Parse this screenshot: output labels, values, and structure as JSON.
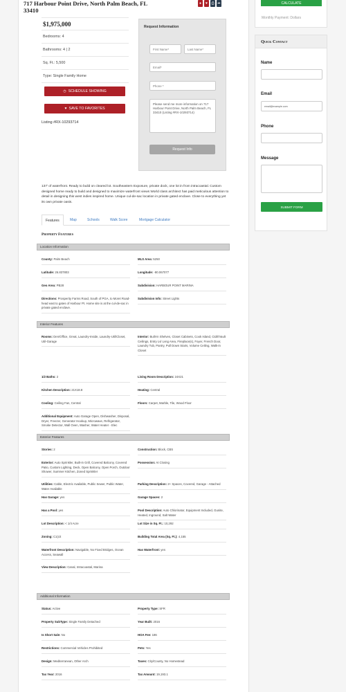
{
  "listing": {
    "address": "717 Harbour Point Drive, North Palm Beach, FL 33410",
    "price": "$1,975,000",
    "summary": [
      "Bedrooms: 4",
      "Bathrooms: 4 | 2",
      "Sq. Ft.: 5,500",
      "Type: Single Family Home"
    ],
    "schedule_label": "SCHEDULE SHOWING",
    "favorites_label": "SAVE TO FAVORITES",
    "listing_number": "Listing #RX-10293714"
  },
  "request_form": {
    "title": "Request Information",
    "first_name_placeholder": "First Name*",
    "last_name_placeholder": "Last Name*",
    "email_placeholder": "Email*",
    "phone_placeholder": "Phone *",
    "message_value": "Please send me more information on 717 Harbour Point Drive, North Palm Beach, FL 33410 (Listing #RX-10293714)",
    "submit_label": "Request Info"
  },
  "description": "137' of waterfront. Ready to build on cleared lot. Southeastern Exposure, private dock, one lot in from intracoastal. Custom designed home ready to build and designed to maximize waterfront views World class architect has paid meticulous attention to detail in designing this west indies inspired home. Unique cul-de-sac location in private gated enclave. Close to everything yet its own private oasis.",
  "tabs": [
    "Features",
    "Map",
    "Schools",
    "Walk Score",
    "Mortgage Calculator"
  ],
  "property_features_heading": "Property Features",
  "sections": [
    {
      "title": "Location Information",
      "items": [
        {
          "label": "County:",
          "value": "Palm Beach"
        },
        {
          "label": "MLS Area:",
          "value": "5250"
        },
        {
          "label": "Latitude:",
          "value": "26.837803"
        },
        {
          "label": "Longitude:",
          "value": "-80.067077"
        },
        {
          "label": "Geo Area:",
          "value": "PB28"
        },
        {
          "label": "Subdivision:",
          "value": "HARBOUR POINT MARINA"
        },
        {
          "label": "Directions:",
          "value": "Prosperity Farms Road, South of PGA, to Moret Road-head east to gates of Harbour Pt. Home site is at the cul-de-sac in private gated enclave."
        },
        {
          "label": "Subdivision Info:",
          "value": "Street Lights"
        }
      ]
    },
    {
      "title": "Interior Features",
      "items": [
        {
          "label": "Rooms:",
          "value": "Den/Office, Great, Laundry-Inside, Laundry-Util/Closet, Util-Garage"
        },
        {
          "label": "Interior:",
          "value": "Built-in Shelves, Closet Cabinets, Cook Island, Ctdrl/Vault Ceilings, Entry Lvl Lvng Area, Fireplace(s), Foyer, French Door, Laundry Tub, Pantry, Pull Down Stairs, Volume Ceiling, Walk-in Closet"
        },
        {
          "label": "1/2 Baths:",
          "value": "2"
        },
        {
          "label": "Living Room Description:",
          "value": "24X21"
        },
        {
          "label": "Kitchen Description:",
          "value": "21X18.8"
        },
        {
          "label": "Heating:",
          "value": "Central"
        },
        {
          "label": "Cooling:",
          "value": "Ceiling Fan, Central"
        },
        {
          "label": "Floors:",
          "value": "Carpet, Marble, Tile, Wood Floor"
        },
        {
          "label": "Additional Equipment:",
          "value": "Auto Garage Open, Dishwasher, Disposal, Dryer, Freezer, Generator Hookup, Microwave, Refrigerator, Smoke Detector, Wall Oven, Washer, Water Heater - Elec"
        }
      ]
    },
    {
      "title": "Exterior Features",
      "items": [
        {
          "label": "Stories:",
          "value": "2"
        },
        {
          "label": "Construction:",
          "value": "Block, CBS"
        },
        {
          "label": "Exterior:",
          "value": "Auto Sprinkler, Built-in Grill, Covered Balcony, Covered Patio, Custom Lighting, Deck, Open Balcony, Open Porch, Outdoor Shower, Summer Kitchen, Zoned Sprinkler"
        },
        {
          "label": "Possession:",
          "value": "At Closing"
        },
        {
          "label": "Utilities:",
          "value": "Cable, Electric Available, Public Sewer, Public Water, Water Available"
        },
        {
          "label": "Parking Description:",
          "value": "2+ Spaces, Covered, Garage - Attached"
        },
        {
          "label": "Has Garage:",
          "value": "yes"
        },
        {
          "label": "Garage Spaces:",
          "value": "2"
        },
        {
          "label": "Has a Pool:",
          "value": "yes"
        },
        {
          "label": "Pool Description:",
          "value": "Auto Chlorinator, Equipment Included, Gunite, Heated, Inground, Salt Water"
        },
        {
          "label": "Lot Description:",
          "value": "< 1/4 Acre"
        },
        {
          "label": "Lot Size in Sq. Ft.:",
          "value": "10,292"
        },
        {
          "label": "Zoning:",
          "value": "C1(cit"
        },
        {
          "label": "Building Total Area (Sq. Ft.):",
          "value": "4,155"
        },
        {
          "label": "Waterfront Description:",
          "value": "Navigable, No Fixed Bridges, Ocean Access, Seawall"
        },
        {
          "label": "Has Waterfront:",
          "value": "yes"
        },
        {
          "label": "View Description:",
          "value": "Canal, Intracoastal, Marina"
        }
      ]
    },
    {
      "title": "Additional Information",
      "items": [
        {
          "label": "Status:",
          "value": "Active"
        },
        {
          "label": "Property Type:",
          "value": "SFR"
        },
        {
          "label": "Property SubType:",
          "value": "Single Family Detached"
        },
        {
          "label": "Year Built:",
          "value": "2016"
        },
        {
          "label": "Is Short Sale:",
          "value": "No"
        },
        {
          "label": "HOA Fee:",
          "value": "186"
        },
        {
          "label": "Restrictions:",
          "value": "Commercial Vehicles Prohibited"
        },
        {
          "label": "Pets:",
          "value": "Yes"
        },
        {
          "label": "Design:",
          "value": "Mediterranean, Other Arch"
        },
        {
          "label": "Taxes:",
          "value": "City/County, No Homestead"
        },
        {
          "label": "Tax Year:",
          "value": "2016"
        },
        {
          "label": "Tax Amount:",
          "value": "19,193.1"
        }
      ]
    }
  ],
  "sidebar": {
    "calculate_label": "CALCULATE",
    "monthly_payment": "Monthly Payment: Dollars",
    "quick_contact_title": "Quick Contact",
    "name_label": "Name",
    "email_label": "Email",
    "email_placeholder": "email@example.com",
    "phone_label": "Phone",
    "message_label": "Message",
    "submit_label": "SUBMIT FORM"
  },
  "colors": {
    "red": "#ad2027",
    "green": "#2aa145",
    "share": [
      "#ad2027",
      "#ad2027",
      "#2c3e50",
      "#2c3e50"
    ]
  }
}
